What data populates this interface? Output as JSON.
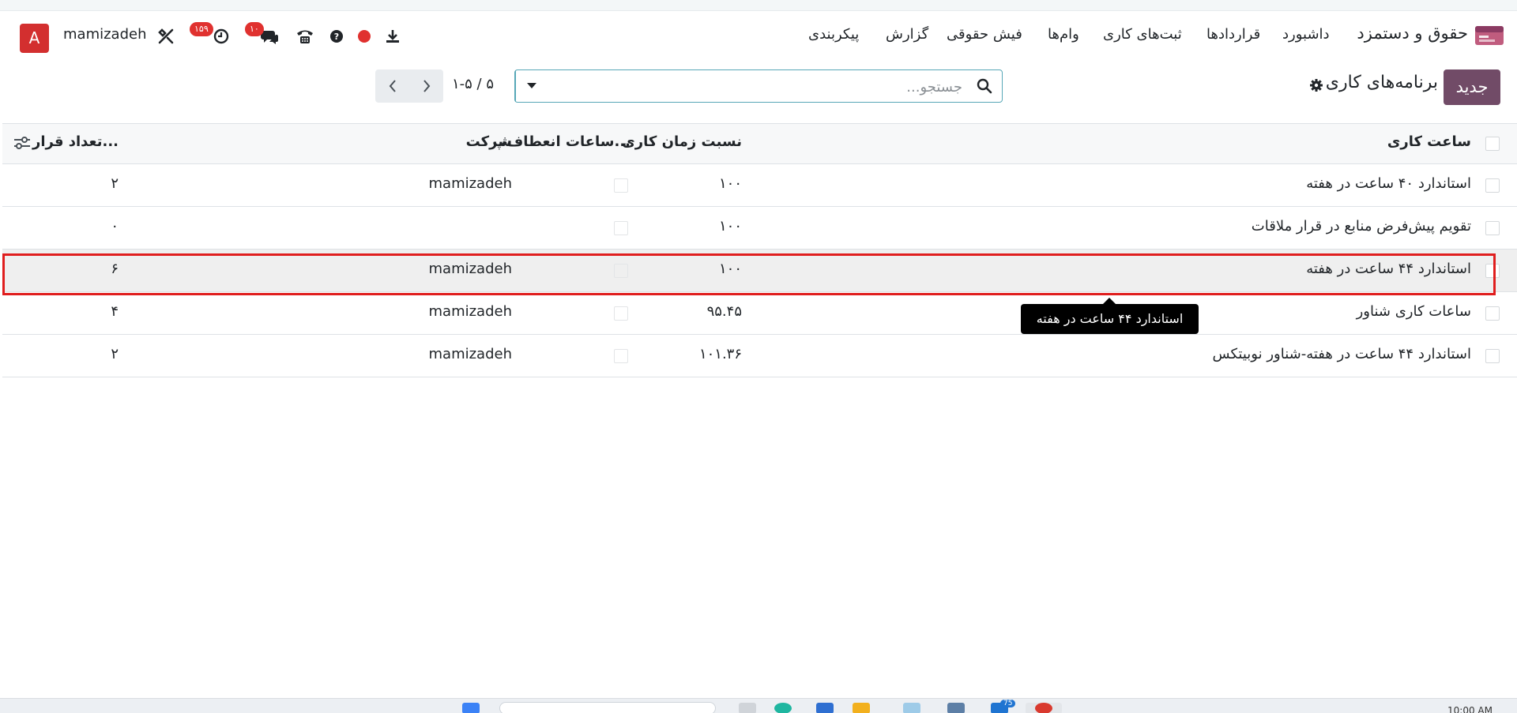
{
  "navbar": {
    "app_name": "حقوق و دستمزد",
    "menu": [
      "داشبورد",
      "قراردادها",
      "ثبت‌های کاری",
      "وام‌ها",
      "فیش حقوقی",
      "گزارش",
      "پیکربندی"
    ],
    "username": "mamizadeh",
    "avatar_letter": "A",
    "activity_badge": "۱۵۹",
    "chat_badge": "۱۰"
  },
  "control": {
    "new_label": "جدید",
    "title": "برنامه‌های کاری",
    "search_placeholder": "جستجو...",
    "pager": "۱-۵ / ۵"
  },
  "table": {
    "columns": {
      "work_hours": "ساعت کاری",
      "time_ratio": "نسبت زمان کاری",
      "flexible": "ساعات انعطاف‌پ...",
      "company": "شرکت",
      "contracts": "تعداد قرار..."
    },
    "rows": [
      {
        "name": "استاندارد ۴۰ ساعت در هفته",
        "ratio": "۱۰۰",
        "company": "mamizadeh",
        "count": "۲"
      },
      {
        "name": "تقویم پیش‌فرض منابع در قرار ملاقات",
        "ratio": "۱۰۰",
        "company": "",
        "count": "۰"
      },
      {
        "name": "استاندارد ۴۴ ساعت در هفته",
        "ratio": "۱۰۰",
        "company": "mamizadeh",
        "count": "۶"
      },
      {
        "name": "ساعات کاری شناور",
        "ratio": "۹۵.۴۵",
        "company": "mamizadeh",
        "count": "۴"
      },
      {
        "name": "استاندارد ۴۴ ساعت در هفته-شناور نوبیتکس",
        "ratio": "۱۰۱.۳۶",
        "company": "mamizadeh",
        "count": "۲"
      }
    ]
  },
  "tooltip": "استاندارد ۴۴ ساعت در هفته",
  "taskbar": {
    "mail_badge": "75",
    "clock": "10:00 AM"
  },
  "colors": {
    "brand": "#714b67",
    "accent": "#57a7b7",
    "highlight": "#e01e1e",
    "badge": "#e0312f"
  }
}
